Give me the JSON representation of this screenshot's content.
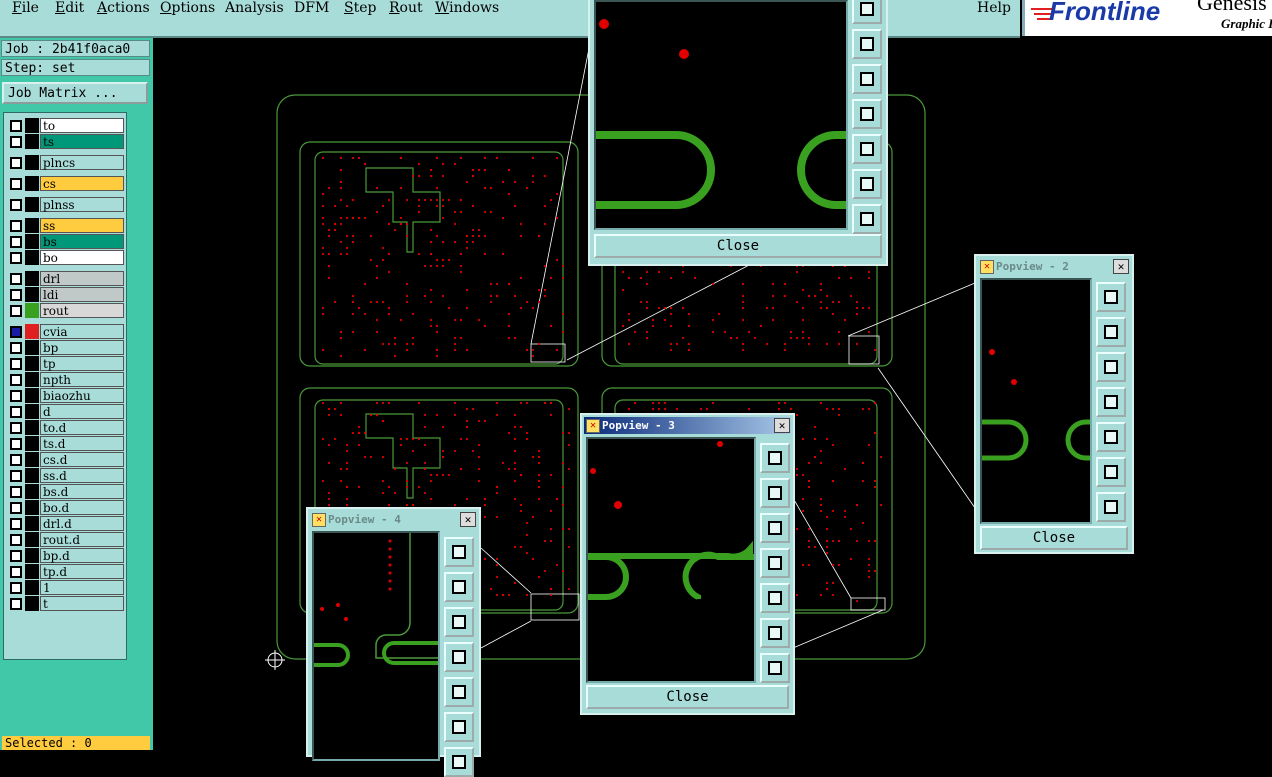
{
  "menubar": {
    "items": [
      {
        "label": "File",
        "u": "F",
        "rest": "ile"
      },
      {
        "label": "Edit",
        "u": "E",
        "rest": "dit"
      },
      {
        "label": "Actions",
        "u": "A",
        "rest": "ctions"
      },
      {
        "label": "Options",
        "u": "O",
        "rest": "ptions"
      },
      {
        "label": "Analysis",
        "u": "",
        "rest": "Analysis"
      },
      {
        "label": "DFM",
        "u": "",
        "rest": "DFM"
      },
      {
        "label": "Step",
        "u": "S",
        "rest": "tep"
      },
      {
        "label": "Rout",
        "u": "R",
        "rest": "out"
      },
      {
        "label": "Windows",
        "u": "W",
        "rest": "indows"
      }
    ],
    "help": "Help"
  },
  "logo": {
    "brand": "Frontline",
    "product": "Genesis",
    "sub": "Graphic I"
  },
  "job": {
    "line": "Job : 2b41f0aca0",
    "step": "Step: set",
    "matrix_button": "Job Matrix ..."
  },
  "layers": [
    {
      "name": "to",
      "color": "#ffffff"
    },
    {
      "name": "ts",
      "color": "#009878"
    },
    {
      "name": "plncs",
      "color": "#a8dcd8"
    },
    {
      "name": "cs",
      "color": "#ffcc40"
    },
    {
      "name": "plnss",
      "color": "#a8dcd8"
    },
    {
      "name": "ss",
      "color": "#ffcc40"
    },
    {
      "name": "bs",
      "color": "#009878"
    },
    {
      "name": "bo",
      "color": "#ffffff"
    },
    {
      "name": "drl",
      "color": "#c0c8c8"
    },
    {
      "name": "ldi",
      "color": "#c0c8c8"
    },
    {
      "name": "rout",
      "color": "#d8d8d8"
    },
    {
      "name": "cvia",
      "color": "#a8dcd8"
    },
    {
      "name": "bp",
      "color": "#a8dcd8"
    },
    {
      "name": "tp",
      "color": "#a8dcd8"
    },
    {
      "name": "npth",
      "color": "#a8dcd8"
    },
    {
      "name": "biaozhu",
      "color": "#a8dcd8"
    },
    {
      "name": "d",
      "color": "#a8dcd8"
    },
    {
      "name": "to.d",
      "color": "#a8dcd8"
    },
    {
      "name": "ts.d",
      "color": "#a8dcd8"
    },
    {
      "name": "cs.d",
      "color": "#a8dcd8"
    },
    {
      "name": "ss.d",
      "color": "#a8dcd8"
    },
    {
      "name": "bs.d",
      "color": "#a8dcd8"
    },
    {
      "name": "bo.d",
      "color": "#a8dcd8"
    },
    {
      "name": "drl.d",
      "color": "#a8dcd8"
    },
    {
      "name": "rout.d",
      "color": "#a8dcd8"
    },
    {
      "name": "bp.d",
      "color": "#a8dcd8"
    },
    {
      "name": "tp.d",
      "color": "#a8dcd8"
    },
    {
      "name": "1",
      "color": "#a8dcd8"
    },
    {
      "name": "t",
      "color": "#a8dcd8"
    }
  ],
  "status": {
    "selected": "Selected : 0"
  },
  "popups": {
    "p1": {
      "close": "Close"
    },
    "p2": {
      "title": "Popview - 2",
      "close": "Close"
    },
    "p3": {
      "title": "Popview - 3",
      "close": "Close"
    },
    "p4": {
      "title": "Popview - 4"
    }
  },
  "colors": {
    "panel": "#a8dcd8",
    "accent": "#40c8a8",
    "trace": "#3aa020",
    "pad": "#e00000",
    "outline": "#4a9a3a"
  }
}
